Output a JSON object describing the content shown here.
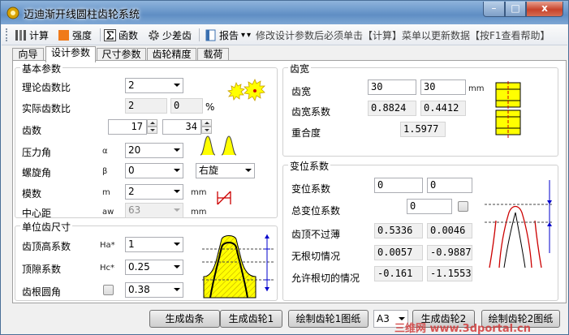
{
  "window": {
    "title": "迈迪渐开线圆柱齿轮系统",
    "min_label": "–",
    "max_label": "□",
    "close_label": "x"
  },
  "toolbar": {
    "calc": "计算",
    "strength": "强度",
    "function": "函数",
    "small_diff": "少差齿",
    "report": "报告",
    "report_arrow": "▾",
    "separator_glyph": "▾",
    "hint": "修改设计参数后必须单击【计算】菜单以更新数据【按F1查看帮助】"
  },
  "tabs": [
    "向导",
    "设计参数",
    "尺寸参数",
    "齿轮精度",
    "载荷"
  ],
  "basic": {
    "title": "基本参数",
    "ratio_label": "理论齿数比",
    "ratio_value": "2",
    "actual_label": "实际齿数比",
    "actual_value": "2",
    "actual_pct": "0",
    "pct_unit": "%",
    "teeth_label": "齿数",
    "teeth1": "17",
    "teeth2": "34",
    "pressure_label": "压力角",
    "pressure_sym": "α",
    "pressure_value": "20",
    "helix_label": "螺旋角",
    "helix_sym": "β",
    "helix_value": "0",
    "helix_dir": "右旋",
    "module_label": "模数",
    "module_sym": "m",
    "module_value": "2",
    "module_unit": "mm",
    "center_label": "中心距",
    "center_sym": "aw",
    "center_value": "63",
    "center_unit": "mm"
  },
  "unit": {
    "title": "单位齿尺寸",
    "addendum_label": "齿顶高系数",
    "addendum_sym": "Ha*",
    "addendum_value": "1",
    "clearance_label": "顶隙系数",
    "clearance_sym": "Hc*",
    "clearance_value": "0.25",
    "root_label": "齿根圆角",
    "root_value": "0.38"
  },
  "width": {
    "title": "齿宽",
    "width_label": "齿宽",
    "w1": "30",
    "w2": "30",
    "unit": "mm",
    "coef_label": "齿宽系数",
    "c1": "0.8824",
    "c2": "0.4412",
    "overlap_label": "重合度",
    "overlap_value": "1.5977"
  },
  "shift": {
    "title": "变位系数",
    "shift_label": "变位系数",
    "s1": "0",
    "s2": "0",
    "total_label": "总变位系数",
    "total_value": "0",
    "thin_label": "齿顶不过薄",
    "t1": "0.5336",
    "t2": "0.0046",
    "nocut_label": "无根切情况",
    "n1": "0.0057",
    "n2": "-0.9887",
    "allow_label": "允许根切的情况",
    "a1": "-0.161",
    "a2": "-1.1553"
  },
  "buttons": {
    "gen_rack": "生成齿条",
    "gen_gear1": "生成齿轮1",
    "draw_gear1": "绘制齿轮1图纸",
    "paper_size": "A3",
    "gen_gear2": "生成齿轮2",
    "draw_gear2": "绘制齿轮2图纸"
  },
  "watermark": "三维网 www.3dportal.cn",
  "colors": {
    "accent_yellow": "#ffff00",
    "title_blue": "#6e9bd0",
    "drawing_red": "#cc0000",
    "drawing_blue": "#0000cc"
  }
}
